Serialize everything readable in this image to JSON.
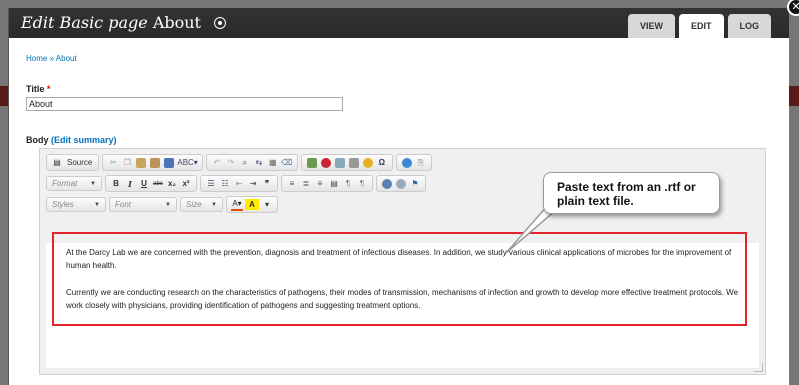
{
  "dialog": {
    "title_italic": "Edit Basic page",
    "title_rest": "About",
    "tabs": [
      {
        "label": "VIEW",
        "active": false
      },
      {
        "label": "EDIT",
        "active": true
      },
      {
        "label": "LOG",
        "active": false
      }
    ]
  },
  "breadcrumb": "Home » About",
  "form": {
    "title_label": "Title",
    "required_marker": "*",
    "title_value": "About",
    "body_label": "Body",
    "body_link_open": "(",
    "edit_summary_label": "Edit summary",
    "body_link_close": ")"
  },
  "toolbar": {
    "source_label": "Source",
    "format_label": "Format",
    "styles_label": "Styles",
    "font_label": "Font",
    "size_label": "Size",
    "bold": "B",
    "italic": "I",
    "underline": "U",
    "strike": "abc",
    "subscript": "x₂",
    "superscript": "x²"
  },
  "editor_content": {
    "paragraph1": "At the Darcy Lab we are concerned with the prevention, diagnosis and treatment of infectious  diseases. In addition, we study various clinical  applications of microbes for the improvement of  human health.",
    "paragraph2": "Currently we are conducting research on the  characteristics of pathogens, their modes of  transmission, mechanisms of infection and growth to develop more effective treatment protocols. We work  closely with physicians, providing identification of  pathogens and suggesting treatment options."
  },
  "callout": {
    "line1": "Paste text from an .rtf or",
    "line2": "plain text file."
  },
  "colors": {
    "accent_link": "#0074bd",
    "highlight_red": "#e3242b",
    "title_bar": "#2f2f2f"
  }
}
